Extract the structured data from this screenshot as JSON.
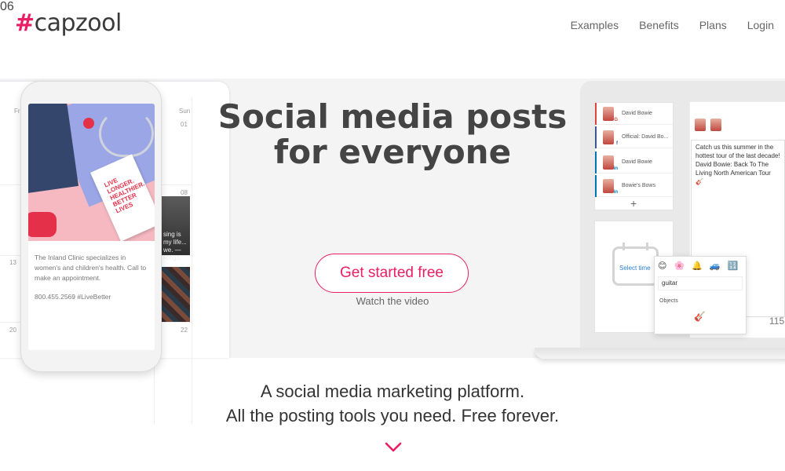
{
  "brand": {
    "hash": "#",
    "name": "capzool"
  },
  "nav": [
    {
      "label": "Examples"
    },
    {
      "label": "Benefits"
    },
    {
      "label": "Plans"
    },
    {
      "label": "Login"
    }
  ],
  "hero": {
    "title_line1": "Social media posts",
    "title_line2": "for everyone",
    "cta": "Get started free",
    "watch": "Watch the video"
  },
  "tagline": {
    "line1": "A social media marketing platform.",
    "line2": "All the posting tools you need. Free forever."
  },
  "calendar": {
    "weekday_left": "Fri",
    "weekday_right": "Sun",
    "days": [
      "01",
      "08",
      "13",
      "06",
      "20",
      "22"
    ],
    "thumb_text": "sing is my life...\nwe.  —Ringo"
  },
  "phone_post": {
    "book_text": "LIVE LONGER. HEALTHIER. BETTER LIVES",
    "text": "The Inland Clinic specializes in women's and children's health. Call to make an appointment.",
    "contact": "800.455.2569 #LiveBetter"
  },
  "laptop": {
    "accounts": [
      {
        "name": "David Bowie",
        "network": "G",
        "color": "#e0453a"
      },
      {
        "name": "Official: David Bo...",
        "network": "f",
        "color": "#3b5998"
      },
      {
        "name": "David Bowie",
        "network": "in",
        "color": "#0077b5"
      },
      {
        "name": "Bowie's Bows",
        "network": "in",
        "color": "#0077b5"
      }
    ],
    "add_symbol": "+",
    "select_time": "Select time",
    "compose_text": "Catch us this summer in the hottest tour of the last decade! David Bowie: Back To The Living North American Tour 🎸",
    "char_count": "115",
    "emoji_tabs": [
      "😊",
      "🌸",
      "🔔",
      "🚙",
      "🔢"
    ],
    "emoji_search": "guitar",
    "emoji_category": "Objects",
    "emoji_result": "🎸"
  },
  "colors": {
    "accent": "#e91e63",
    "text": "#444444",
    "band": "#f4f4f5"
  }
}
